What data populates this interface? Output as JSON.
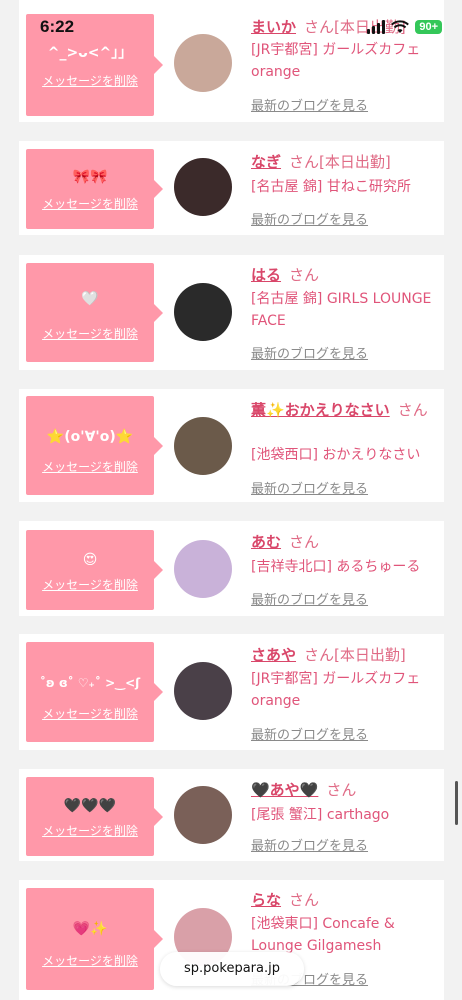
{
  "status": {
    "time": "6:22",
    "battery": "90+"
  },
  "url": "sp.pokepara.jp",
  "delete_label": "メッセージを削除",
  "blog_label": "最新のブログを見る",
  "san_label": "さん",
  "cards": [
    {
      "message": "^_>ᴗ<^」」",
      "name": "まいか",
      "suffix": "[本日出勤]",
      "shop": "[JR宇都宮] ガールズカフェ orange",
      "avatar_color": "#c9a89a"
    },
    {
      "message": "🎀🎀",
      "name": "なぎ",
      "suffix": "[本日出勤]",
      "shop": "[名古屋 錦] 甘ねこ研究所",
      "avatar_color": "#3b2a2a"
    },
    {
      "message": "🤍",
      "name": "はる",
      "suffix": "",
      "shop": "[名古屋 錦] GIRLS LOUNGE FACE",
      "avatar_color": "#2a2a2a"
    },
    {
      "message": "⭐️(o'∀'o)⭐️",
      "name": "薫✨おかえりなさい",
      "suffix": "",
      "shop": "[池袋西口] おかえりなさい",
      "avatar_color": "#6b5a4a"
    },
    {
      "message": "😍",
      "name": "あむ",
      "suffix": "",
      "shop": "[吉祥寺北口] あるちゅーる",
      "avatar_color": "#c9b2d9"
    },
    {
      "message": "˚ʚ ɞ˚ ♡₊˚ >‿<ʃ",
      "name": "さあや",
      "suffix": "[本日出勤]",
      "shop": "[JR宇都宮] ガールズカフェ orange",
      "avatar_color": "#4a4048"
    },
    {
      "message": "🖤🖤🖤",
      "name": "🖤あや🖤",
      "suffix": "",
      "shop": "[尾張 蟹江] carthago",
      "avatar_color": "#7a6058"
    },
    {
      "message": "💗✨",
      "name": "らな",
      "suffix": "",
      "shop": "[池袋東口] Concafe & Lounge Gilgamesh",
      "avatar_color": "#d9a0a8"
    }
  ]
}
